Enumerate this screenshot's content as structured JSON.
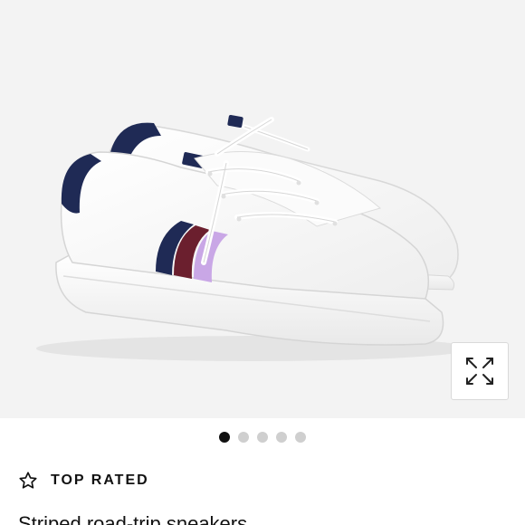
{
  "gallery": {
    "image_subject": "white sneaker with navy heel tab and navy, burgundy, lavender side stripes",
    "expand_icon": "expand-arrows-icon",
    "dots": [
      {
        "active": true
      },
      {
        "active": false
      },
      {
        "active": false
      },
      {
        "active": false
      },
      {
        "active": false
      }
    ]
  },
  "badge": {
    "icon": "star-outline-icon",
    "label": "TOP RATED"
  },
  "product": {
    "title": "Striped road-trip sneakers"
  },
  "colors": {
    "gallery_background": "#f3f3f3",
    "navy": "#1f2a55",
    "burgundy": "#6b1f2e",
    "lavender": "#c9a7e6",
    "active_dot": "#111111",
    "inactive_dot": "#cfcfcf"
  }
}
